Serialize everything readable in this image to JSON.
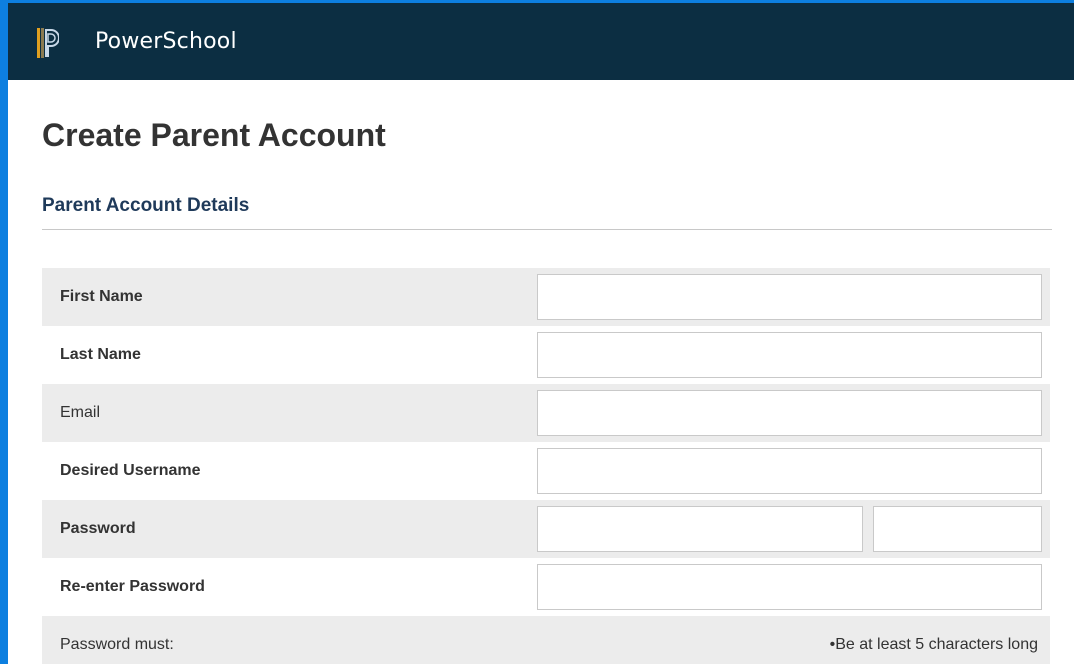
{
  "header": {
    "brand": "PowerSchool",
    "logo_icon": "powerschool-logo-icon"
  },
  "page": {
    "title": "Create Parent Account"
  },
  "section": {
    "title": "Parent Account Details"
  },
  "form": {
    "first_name": {
      "label": "First Name",
      "value": "",
      "placeholder": ""
    },
    "last_name": {
      "label": "Last Name",
      "value": "",
      "placeholder": ""
    },
    "email": {
      "label": "Email",
      "value": "",
      "placeholder": ""
    },
    "username": {
      "label": "Desired Username",
      "value": "",
      "placeholder": ""
    },
    "password": {
      "label": "Password",
      "value": "",
      "placeholder": ""
    },
    "reenter_password": {
      "label": "Re-enter Password",
      "value": "",
      "placeholder": ""
    },
    "password_rules": {
      "label": "Password must:",
      "items": [
        "•Be at least 5 characters long"
      ]
    }
  },
  "colors": {
    "header_bg": "#0c2e42",
    "frame_border": "#0d7fe0",
    "row_shade": "#ececec"
  }
}
